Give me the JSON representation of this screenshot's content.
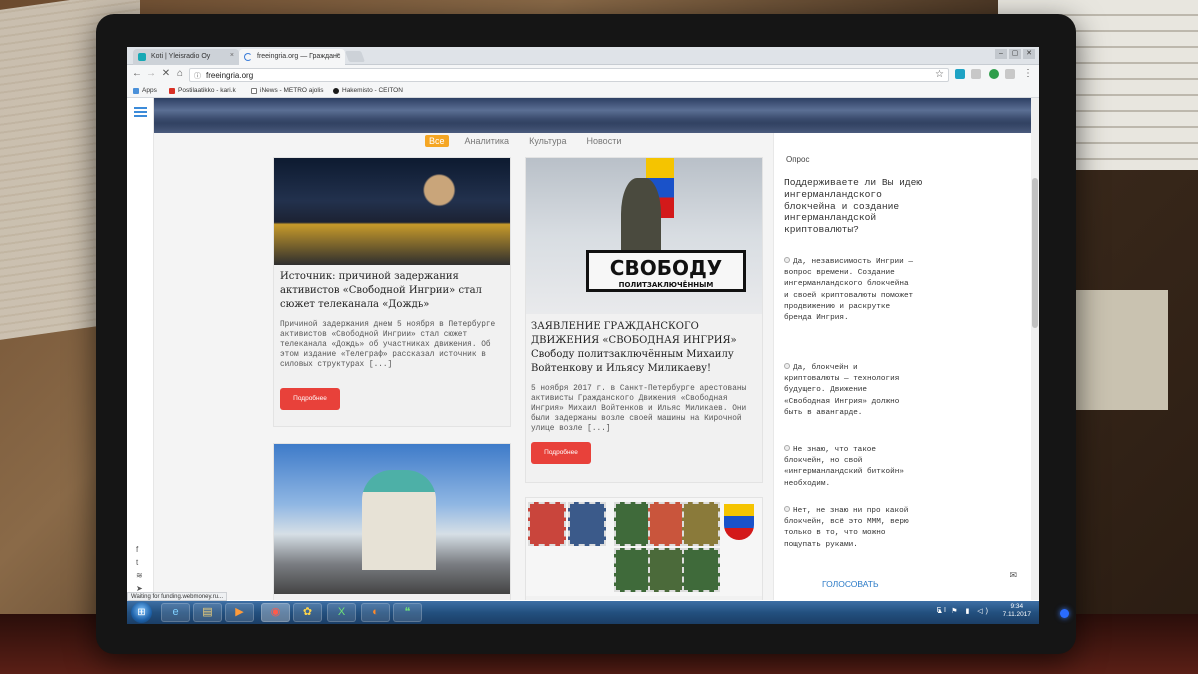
{
  "browser": {
    "tabs": [
      {
        "label": "Koti | Yleisradio Oy",
        "close": "×"
      },
      {
        "label": "freeingria.org — Гражданс",
        "close": "×"
      }
    ],
    "window_controls": [
      "–",
      "▢",
      "✕"
    ],
    "nav": {
      "back": "←",
      "forward": "→",
      "stop": "✕",
      "home": "⌂"
    },
    "address": "freeingria.org",
    "address_info": "ⓘ",
    "star": "☆",
    "bookmarks": [
      {
        "label": "Apps",
        "color": "#4a90d9"
      },
      {
        "label": "Postilaatikko - kari.k",
        "color": "#d93025"
      },
      {
        "label": "iNews - METRO ajolis",
        "color": "#777777"
      },
      {
        "label": "Hakemisto - CEITON",
        "color": "#1a1a1a"
      }
    ],
    "status": "Waiting for funding.webmoney.ru..."
  },
  "site": {
    "social_icons": [
      {
        "name": "facebook-icon",
        "glyph": "f"
      },
      {
        "name": "twitter-icon",
        "glyph": "t"
      },
      {
        "name": "rss-icon",
        "glyph": "≋"
      },
      {
        "name": "telegram-icon",
        "glyph": "➤"
      }
    ],
    "filters": [
      "Все",
      "Аналитика",
      "Культура",
      "Новости"
    ],
    "filters_active": "Все",
    "articles": [
      {
        "title": "Источник: причиной задержания активистов «Свободной Ингрии» стал сюжет телеканала «Дождь»",
        "excerpt": "Причиной задержания днем 5 ноября в Петербурге активистов «Свободной Ингрии» стал сюжет телеканала «Дождь» об участниках движения. Об этом издание «Телеграф» рассказал источник в силовых структурах  [...]",
        "button": "Подробнее"
      },
      {
        "image_sign": "СВОБОДУ",
        "image_sign_sub": "ПОЛИТЗАКЛЮЧЁННЫМ",
        "title": "ЗАЯВЛЕНИЕ ГРАЖДАНСКОГО ДВИЖЕНИЯ «СВОБОДНАЯ ИНГРИЯ» Свободу политзаключённым Михаилу Войтенкову и Ильясу Миликаеву!",
        "excerpt": "5 ноября 2017 г. в Санкт-Петербурге арестованы активисты Гражданского Движения «Свободная Ингрия» Михаил Войтенков и Ильяс Миликаев. Они были задержаны возле своей машины на Кирочной улице возле [...]",
        "button": "Подробнее"
      }
    ],
    "poll": {
      "heading": "Опрос",
      "question": "Поддерживаете ли Вы идею ингерманландского блокчейна и создание ингерманландской криптовалюты?",
      "options": [
        "Да, независимость Ингрии — вопрос времени. Создание ингерманландского блокчейна и своей криптовалюты поможет продвижению и раскрутке бренда Ингрия.",
        "Да, блокчейн и криптовалюты — технология будущего. Движение «Свободная Ингрия» должно быть в авангарде.",
        "Не знаю, что такое блокчейн, но свой «ингерманландский биткойн» необходим.",
        "Нет, не знаю ни про какой блокчейн, всё это МММ, верю только в то, что можно пощупать руками."
      ],
      "vote": "ГОЛОСОВАТЬ",
      "mail_icon": "✉"
    }
  },
  "taskbar": {
    "start": "⊞",
    "apps": [
      {
        "name": "ie-icon",
        "glyph": "e"
      },
      {
        "name": "explorer-icon",
        "glyph": "▤"
      },
      {
        "name": "media-player-icon",
        "glyph": "▶"
      },
      {
        "name": "chrome-icon",
        "glyph": "◉"
      },
      {
        "name": "photos-icon",
        "glyph": "✿"
      },
      {
        "name": "excel-icon",
        "glyph": "X"
      },
      {
        "name": "firefox-icon",
        "glyph": "◐"
      },
      {
        "name": "hangouts-icon",
        "glyph": "❝"
      }
    ],
    "lang": "FI",
    "tray_icons": "▲ ⚑ ▮ ◁)",
    "time": "9:34",
    "date": "7.11.2017"
  }
}
